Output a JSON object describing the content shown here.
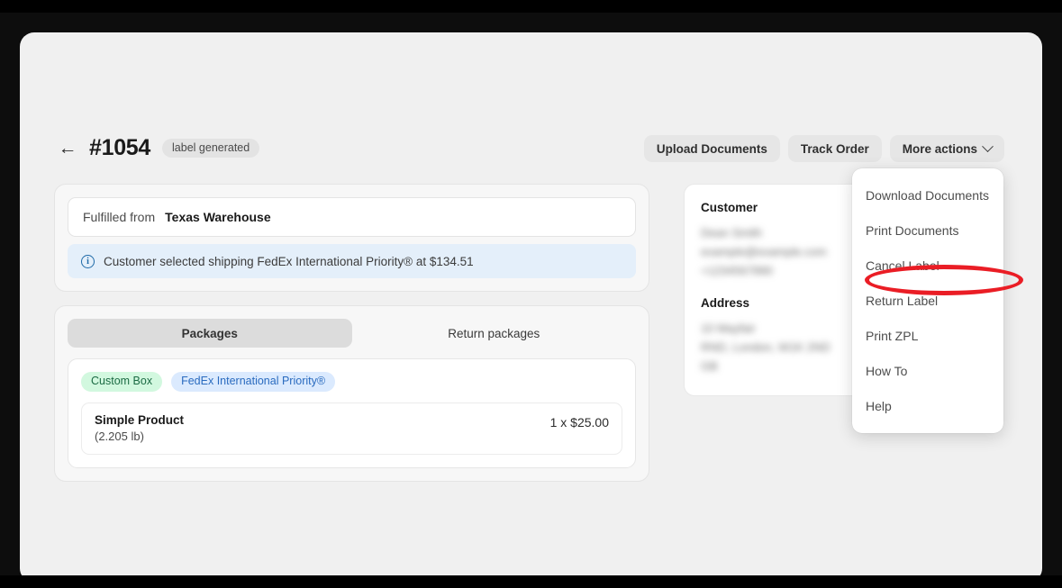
{
  "header": {
    "back_icon": "arrow-left-icon",
    "order_number": "#1054",
    "status_badge": "label generated",
    "actions": [
      {
        "label": "Upload Documents",
        "has_chevron": false
      },
      {
        "label": "Track Order",
        "has_chevron": false
      },
      {
        "label": "More actions",
        "has_chevron": true
      }
    ]
  },
  "fulfillment": {
    "fulfilled_from_label": "Fulfilled from",
    "fulfilled_from_value": "Texas Warehouse",
    "notice_icon": "info-circle-icon",
    "notice_text": "Customer selected shipping FedEx International Priority®  at  $134.51"
  },
  "packages": {
    "tabs": [
      {
        "label": "Packages",
        "active": true
      },
      {
        "label": "Return packages",
        "active": false
      }
    ],
    "badges": [
      {
        "label": "Custom Box",
        "color": "#d2f8df",
        "text_color": "#1c6b44"
      },
      {
        "label": "FedEx International Priority®",
        "color": "#dbeafe",
        "text_color": "#2a6bbf"
      }
    ],
    "line_items": [
      {
        "name": "Simple Product",
        "weight": "(2.205 lb)",
        "price": "1 x $25.00"
      }
    ]
  },
  "customer_panel": {
    "customer_heading": "Customer",
    "customer_lines": [
      "Dean Smith",
      "example@example.com",
      "+1234567890"
    ],
    "address_heading": "Address",
    "address_lines": [
      "10 Mayfair",
      "RND, London, W1K 2ND",
      "GB"
    ]
  },
  "more_actions_menu": {
    "items": [
      {
        "label": "Download Documents",
        "highlighted": false
      },
      {
        "label": "Print Documents",
        "highlighted": false
      },
      {
        "label": "Cancel Label",
        "highlighted": true
      },
      {
        "label": "Return Label",
        "highlighted": false
      },
      {
        "label": "Print ZPL",
        "highlighted": false
      },
      {
        "label": "How To",
        "highlighted": false
      },
      {
        "label": "Help",
        "highlighted": false
      }
    ]
  },
  "annotation": {
    "target": "Cancel Label",
    "shape": "ellipse",
    "color": "#ea1d25"
  }
}
